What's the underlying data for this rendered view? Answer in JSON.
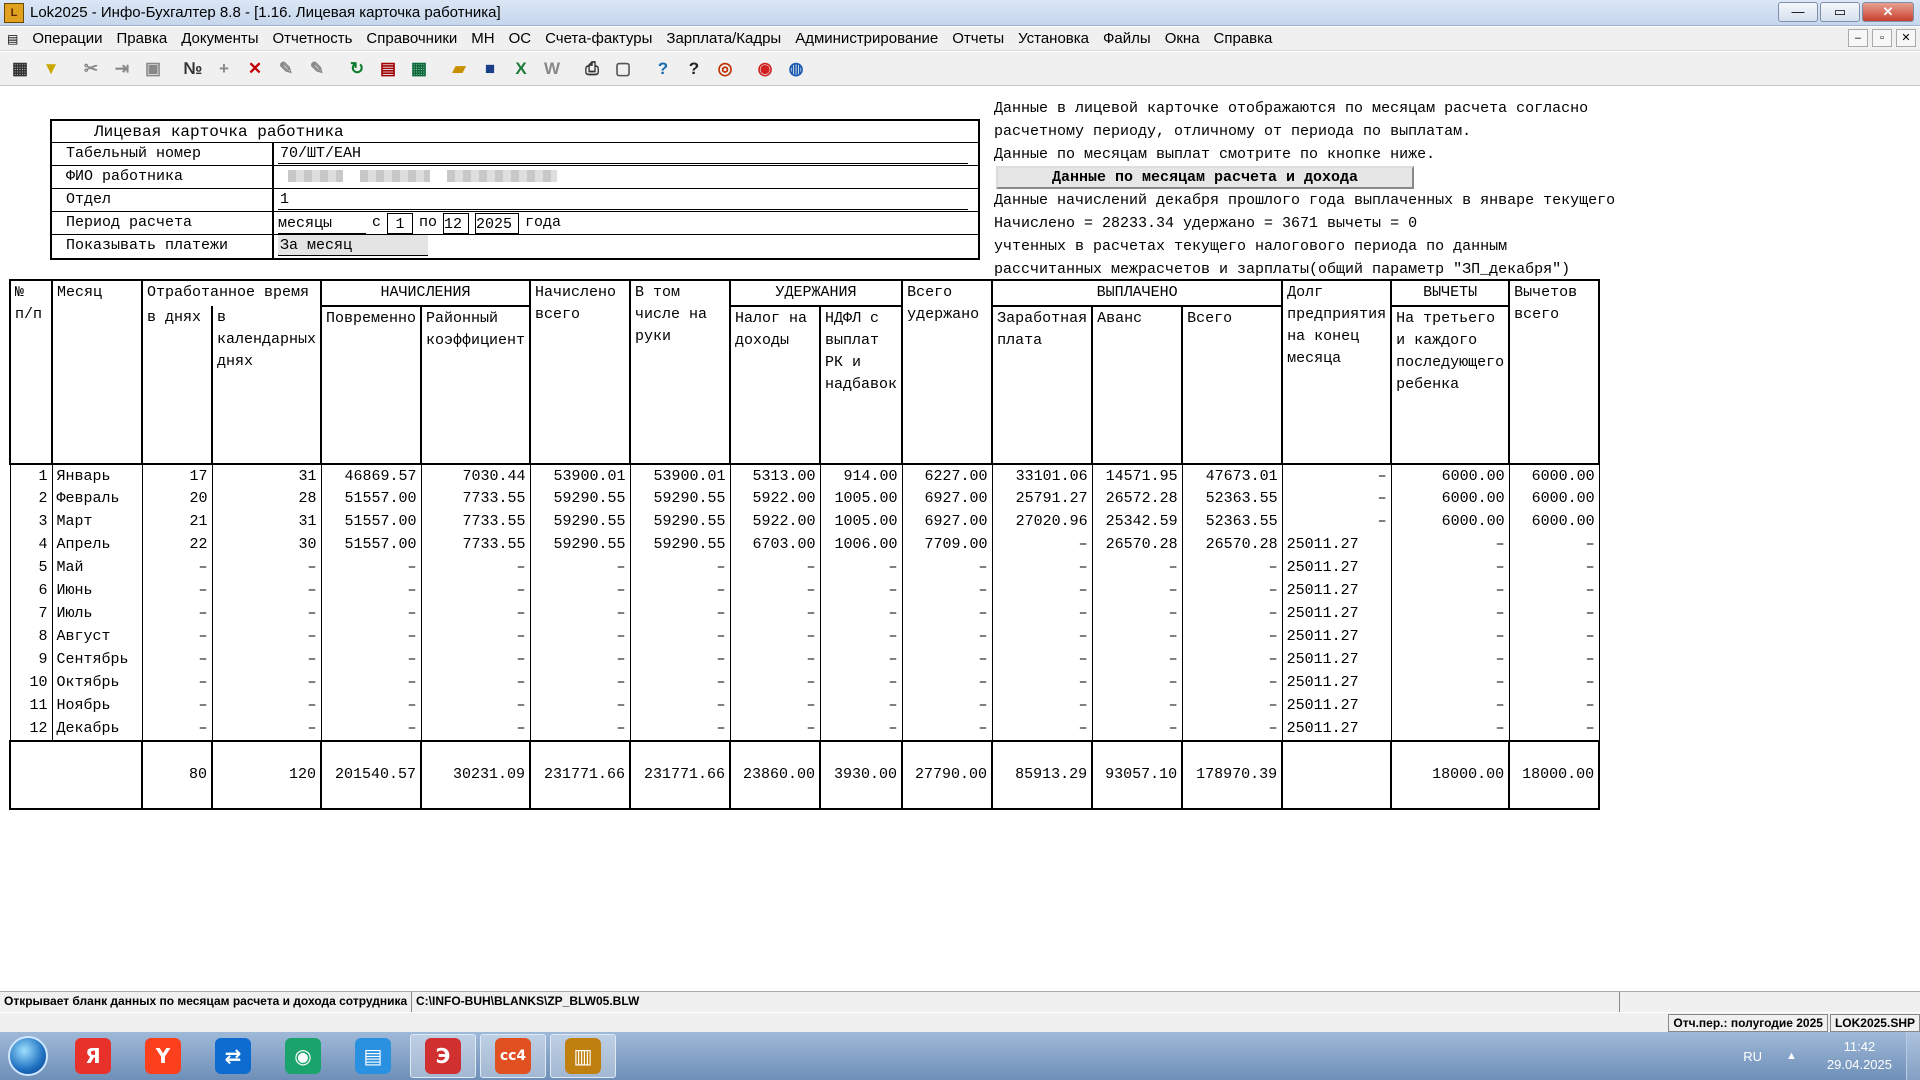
{
  "window": {
    "title": "Lok2025 - Инфо-Бухгалтер 8.8 - [1.16. Лицевая карточка работника]",
    "icon_label": "L",
    "min": "—",
    "max": "▭",
    "close": "✕"
  },
  "menu": [
    "Операции",
    "Правка",
    "Документы",
    "Отчетность",
    "Справочники",
    "МН",
    "ОС",
    "Счета-фактуры",
    "Зарплата/Кадры",
    "Администрирование",
    "Отчеты",
    "Установка",
    "Файлы",
    "Окна",
    "Справка"
  ],
  "mdi": {
    "min": "–",
    "restore": "▫",
    "close": "✕"
  },
  "toolbar": [
    {
      "name": "grid-icon",
      "glyph": "▦",
      "color": "#333"
    },
    {
      "name": "filter-icon",
      "glyph": "▼",
      "color": "#c8a800"
    },
    {
      "name": "cut-icon",
      "glyph": "✂",
      "color": "#888"
    },
    {
      "name": "move-icon",
      "glyph": "⇥",
      "color": "#888"
    },
    {
      "name": "paste-icon",
      "glyph": "▣",
      "color": "#888"
    },
    {
      "name": "number-icon",
      "glyph": "№",
      "color": "#333"
    },
    {
      "name": "add-icon",
      "glyph": "+",
      "color": "#888"
    },
    {
      "name": "delete-icon",
      "glyph": "✕",
      "color": "#c00000"
    },
    {
      "name": "pen-icon",
      "glyph": "✎",
      "color": "#888"
    },
    {
      "name": "pen-alt-icon",
      "glyph": "✎",
      "color": "#888"
    },
    {
      "name": "refresh-icon",
      "glyph": "↻",
      "color": "#0a7a2a"
    },
    {
      "name": "calendar-icon",
      "glyph": "▤",
      "color": "#a00000"
    },
    {
      "name": "calculator-icon",
      "glyph": "▦",
      "color": "#0a6a3a"
    },
    {
      "name": "open-folder-icon",
      "glyph": "▰",
      "color": "#c89000"
    },
    {
      "name": "save-icon",
      "glyph": "■",
      "color": "#1a3f8a"
    },
    {
      "name": "excel-icon",
      "glyph": "X",
      "color": "#1d7a3a"
    },
    {
      "name": "word-icon",
      "glyph": "W",
      "color": "#888"
    },
    {
      "name": "print-icon",
      "glyph": "⎙",
      "color": "#333"
    },
    {
      "name": "preview-icon",
      "glyph": "▢",
      "color": "#555"
    },
    {
      "name": "help-icon",
      "glyph": "?",
      "color": "#1a6ab0"
    },
    {
      "name": "context-help-icon",
      "glyph": "?",
      "color": "#222"
    },
    {
      "name": "compass-icon",
      "glyph": "◎",
      "color": "#c03000"
    },
    {
      "name": "lifebuoy-icon",
      "glyph": "◉",
      "color": "#d02020"
    },
    {
      "name": "globe-icon",
      "glyph": "◍",
      "color": "#1a5ab0"
    }
  ],
  "card": {
    "title": "Лицевая карточка работника",
    "rows": {
      "tab_label": "Табельный номер",
      "tab_value": "70/ШТ/ЕАН",
      "fio_label": "ФИО работника",
      "dept_label": "Отдел",
      "dept_value": "1",
      "period_label": "Период расчета",
      "period_unit": "месяцы",
      "period_from_word": "с",
      "period_from": "1",
      "period_to_word": "по",
      "period_to": "12",
      "period_year": "2025",
      "period_year_word": "года",
      "pay_label": "Показывать платежи",
      "pay_value": "За месяц"
    }
  },
  "info": {
    "line1": "Данные в лицевой карточке отображаются по месяцам расчета согласно",
    "line2": "расчетному периоду, отличному от периода по выплатам.",
    "line3": "Данные по месяцам выплат смотрите по кнопке ниже.",
    "button": "Данные по месяцам расчета и дохода",
    "line4": "Данные начислений декабря прошлого года выплаченных в январе текущего",
    "line5": "Начислено = 28233.34 удержано = 3671 вычеты = 0",
    "line6": "учтенных в расчетах текущего налогового периода по данным",
    "line7": "рассчитанных межрасчетов и зарплаты(общий параметр \"ЗП_декабря\")"
  },
  "table": {
    "headers": {
      "num": "№ п/п",
      "month": "Месяц",
      "worked": "Отработанное время",
      "accruals": "НАЧИСЛЕНИЯ",
      "accrued_total": "Начислено всего",
      "in_hand": "В том числе на руки",
      "deductions": "УДЕРЖАНИЯ",
      "total_deducted": "Всего удержано",
      "paid": "ВЫПЛАЧЕНО",
      "debt": "Долг предприятия на конец месяца",
      "tax_deductions": "ВЫЧЕТЫ",
      "deductions_total": "Вычетов всего",
      "days": "в днях",
      "cal_days": "в календарных днях",
      "time_pay": "Повременно",
      "district_coef": "Районный коэффициент",
      "income_tax": "Налог на доходы",
      "ndfl_rk": "НДФЛ с выплат РК и надбавок",
      "salary": "Заработная плата",
      "advance": "Аванс",
      "paid_total": "Всего",
      "third_child": "На третьего и каждого последующего ребенка"
    },
    "rows": [
      [
        "1",
        "Январь",
        "17",
        "31",
        "46869.57",
        "7030.44",
        "53900.01",
        "53900.01",
        "5313.00",
        "914.00",
        "6227.00",
        "33101.06",
        "14571.95",
        "47673.01",
        "–",
        "6000.00",
        "6000.00"
      ],
      [
        "2",
        "Февраль",
        "20",
        "28",
        "51557.00",
        "7733.55",
        "59290.55",
        "59290.55",
        "5922.00",
        "1005.00",
        "6927.00",
        "25791.27",
        "26572.28",
        "52363.55",
        "–",
        "6000.00",
        "6000.00"
      ],
      [
        "3",
        "Март",
        "21",
        "31",
        "51557.00",
        "7733.55",
        "59290.55",
        "59290.55",
        "5922.00",
        "1005.00",
        "6927.00",
        "27020.96",
        "25342.59",
        "52363.55",
        "–",
        "6000.00",
        "6000.00"
      ],
      [
        "4",
        "Апрель",
        "22",
        "30",
        "51557.00",
        "7733.55",
        "59290.55",
        "59290.55",
        "6703.00",
        "1006.00",
        "7709.00",
        "–",
        "26570.28",
        "26570.28",
        "25011.27",
        "–",
        "–"
      ],
      [
        "5",
        "Май",
        "–",
        "–",
        "–",
        "–",
        "–",
        "–",
        "–",
        "–",
        "–",
        "–",
        "–",
        "–",
        "25011.27",
        "–",
        "–"
      ],
      [
        "6",
        "Июнь",
        "–",
        "–",
        "–",
        "–",
        "–",
        "–",
        "–",
        "–",
        "–",
        "–",
        "–",
        "–",
        "25011.27",
        "–",
        "–"
      ],
      [
        "7",
        "Июль",
        "–",
        "–",
        "–",
        "–",
        "–",
        "–",
        "–",
        "–",
        "–",
        "–",
        "–",
        "–",
        "25011.27",
        "–",
        "–"
      ],
      [
        "8",
        "Август",
        "–",
        "–",
        "–",
        "–",
        "–",
        "–",
        "–",
        "–",
        "–",
        "–",
        "–",
        "–",
        "25011.27",
        "–",
        "–"
      ],
      [
        "9",
        "Сентябрь",
        "–",
        "–",
        "–",
        "–",
        "–",
        "–",
        "–",
        "–",
        "–",
        "–",
        "–",
        "–",
        "25011.27",
        "–",
        "–"
      ],
      [
        "10",
        "Октябрь",
        "–",
        "–",
        "–",
        "–",
        "–",
        "–",
        "–",
        "–",
        "–",
        "–",
        "–",
        "–",
        "25011.27",
        "–",
        "–"
      ],
      [
        "11",
        "Ноябрь",
        "–",
        "–",
        "–",
        "–",
        "–",
        "–",
        "–",
        "–",
        "–",
        "–",
        "–",
        "–",
        "25011.27",
        "–",
        "–"
      ],
      [
        "12",
        "Декабрь",
        "–",
        "–",
        "–",
        "–",
        "–",
        "–",
        "–",
        "–",
        "–",
        "–",
        "–",
        "–",
        "25011.27",
        "–",
        "–"
      ]
    ],
    "totals": [
      "",
      "80",
      "120",
      "201540.57",
      "30231.09",
      "231771.66",
      "231771.66",
      "23860.00",
      "3930.00",
      "27790.00",
      "85913.29",
      "93057.10",
      "178970.39",
      "",
      "18000.00",
      "18000.00"
    ]
  },
  "status": {
    "message": "Открывает бланк данных по месяцам расчета и дохода сотрудника",
    "path": "C:\\INFO-BUH\\BLANKS\\ZP_BLW05.BLW",
    "period": "Отч.пер.: полугодие 2025",
    "file": "LOK2025.SHP"
  },
  "taskbar": {
    "apps": [
      {
        "name": "yandex-browser-icon",
        "glyph": "Я",
        "color": "#e8312a"
      },
      {
        "name": "yandex-icon",
        "glyph": "Y",
        "color": "#fc3f1d"
      },
      {
        "name": "teamviewer-icon",
        "glyph": "⇄",
        "color": "#0e6bd0"
      },
      {
        "name": "messenger-icon",
        "glyph": "◉",
        "color": "#1aa36a"
      },
      {
        "name": "chat-icon",
        "glyph": "▤",
        "color": "#2a90e0"
      },
      {
        "name": "circle-app-icon",
        "glyph": "Э",
        "color": "#d03030"
      },
      {
        "name": "cc4-icon",
        "glyph": "cc4",
        "color": "#e05020"
      },
      {
        "name": "abacus-icon",
        "glyph": "▥",
        "color": "#c08010"
      }
    ],
    "lang": "RU",
    "time": "11:42",
    "date": "29.04.2025"
  }
}
